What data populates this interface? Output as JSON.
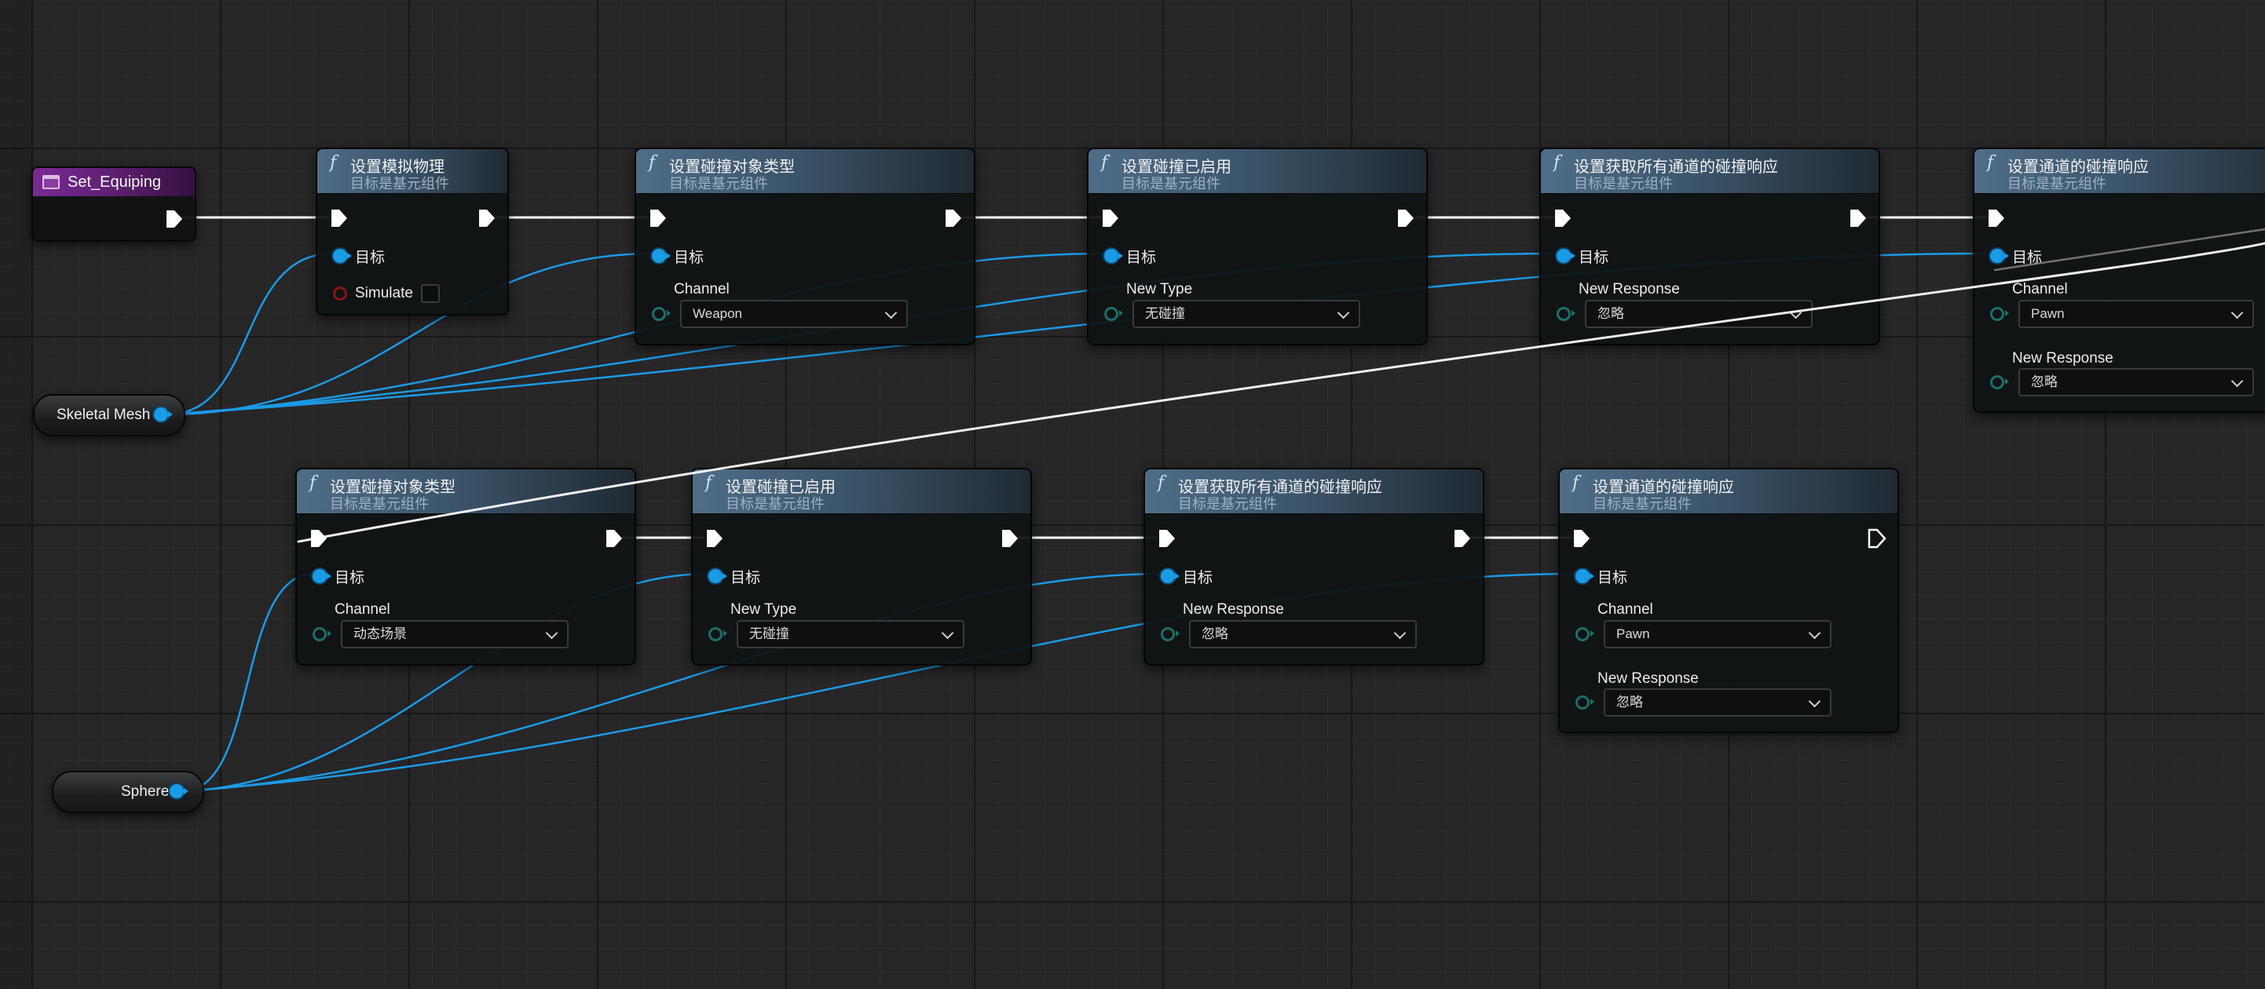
{
  "event": {
    "title": "Set_Equiping"
  },
  "variables": {
    "skeletal_mesh": "Skeletal Mesh",
    "sphere": "Sphere"
  },
  "common": {
    "subtitle": "目标是基元组件",
    "target": "目标",
    "simulate": "Simulate",
    "channel": "Channel",
    "new_type": "New Type",
    "new_response": "New Response"
  },
  "row1": [
    {
      "title": "设置模拟物理"
    },
    {
      "title": "设置碰撞对象类型",
      "channel_value": "Weapon"
    },
    {
      "title": "设置碰撞已启用",
      "new_type_value": "无碰撞"
    },
    {
      "title": "设置获取所有通道的碰撞响应",
      "new_response_value": "忽略"
    },
    {
      "title": "设置通道的碰撞响应",
      "channel_value": "Pawn",
      "new_response_value": "忽略"
    }
  ],
  "row2": [
    {
      "title": "设置碰撞对象类型",
      "channel_value": "动态场景"
    },
    {
      "title": "设置碰撞已启用",
      "new_type_value": "无碰撞"
    },
    {
      "title": "设置获取所有通道的碰撞响应",
      "new_response_value": "忽略"
    },
    {
      "title": "设置通道的碰撞响应",
      "channel_value": "Pawn",
      "new_response_value": "忽略"
    }
  ],
  "colors": {
    "object_pin": "#1a9be6",
    "exec_wire": "#ffffff",
    "event_header": "#7a2a93",
    "function_header": "#4f6d87",
    "bool_pin": "#8a1414",
    "enum_pin": "#1c6f6b"
  },
  "icons": [
    "function-icon",
    "event-icon",
    "exec-pin-icon",
    "chevron-down-icon"
  ]
}
